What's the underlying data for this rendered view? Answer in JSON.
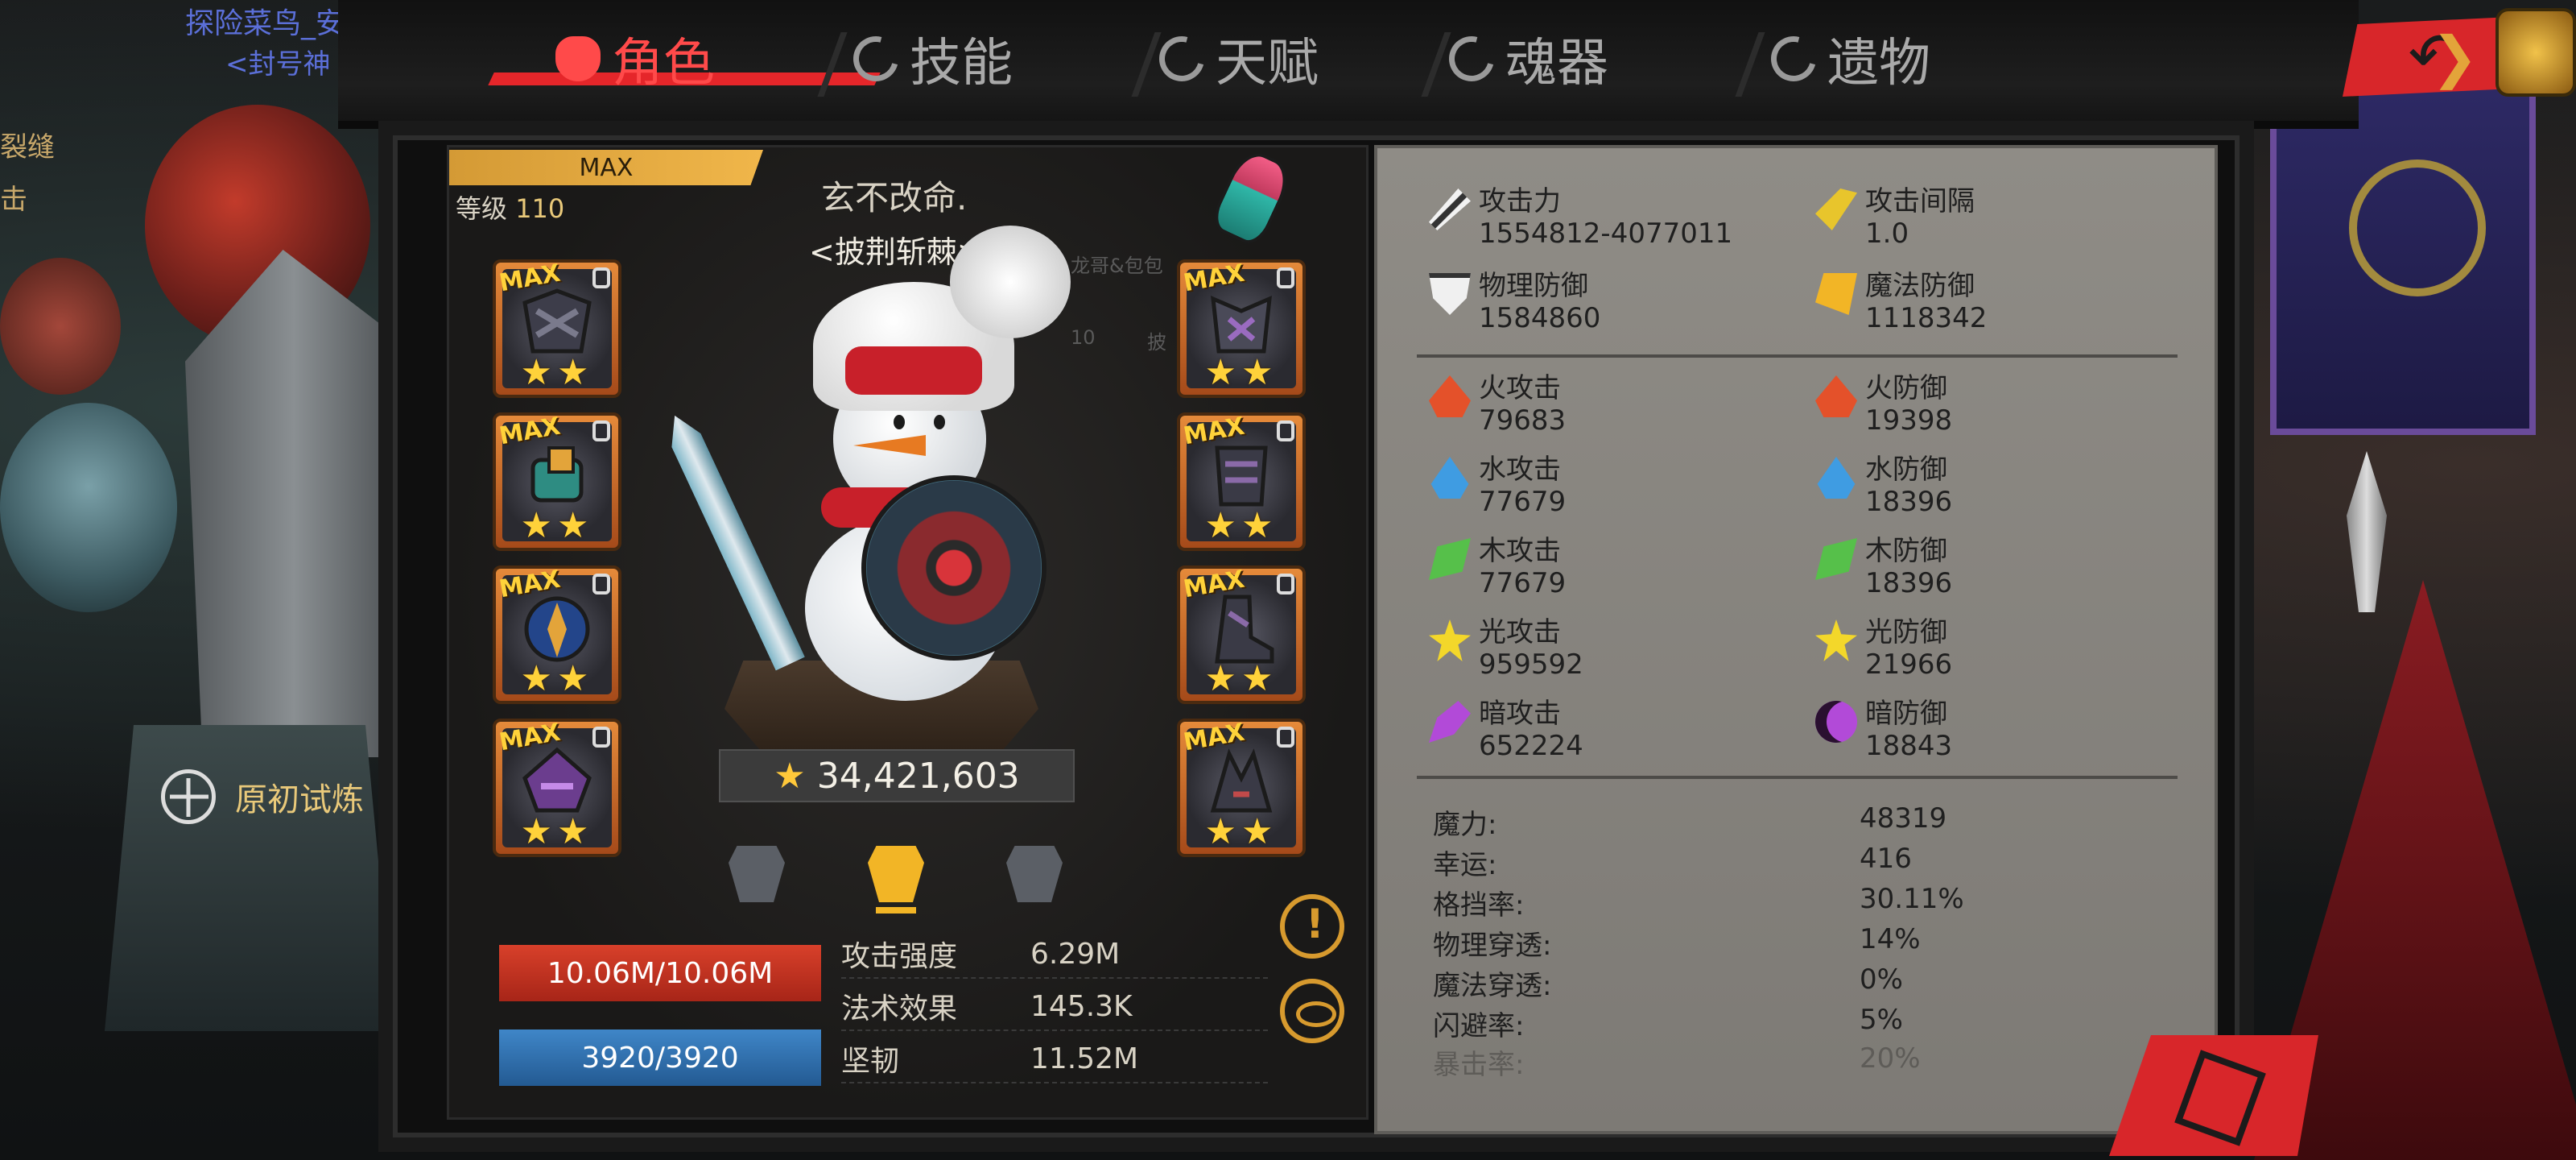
{
  "player": {
    "name": "探险菜鸟_安",
    "title": "<封号神"
  },
  "side_texts": [
    "裂缝",
    "击"
  ],
  "trial_button": {
    "label": "原初试炼",
    "icon": "crosshair-icon"
  },
  "tabs": [
    {
      "label": "角色",
      "icon": "devil-icon",
      "active": true
    },
    {
      "label": "技能",
      "icon": "swirl-icon",
      "active": false
    },
    {
      "label": "天赋",
      "icon": "flame-diamond-icon",
      "active": false
    },
    {
      "label": "魂器",
      "icon": "soul-icon",
      "active": false
    },
    {
      "label": "遗物",
      "icon": "relic-icon",
      "active": false
    }
  ],
  "character": {
    "rank_label": "MAX",
    "level_label": "等级",
    "level_value": "110",
    "name": "玄不改命.",
    "title": "<披荆斩棘>",
    "faint_text_1": "龙哥&包包",
    "faint_text_2": "10",
    "faint_text_3": "披",
    "power_score": "34,421,603"
  },
  "equipment_left": [
    {
      "name": "helmet",
      "tag": "MAX",
      "stars": "★★"
    },
    {
      "name": "bracer",
      "tag": "MAX",
      "stars": "★★"
    },
    {
      "name": "emblem",
      "tag": "MAX",
      "stars": "★★"
    },
    {
      "name": "hood",
      "tag": "MAX",
      "stars": "★★"
    }
  ],
  "equipment_right": [
    {
      "name": "chest",
      "tag": "MAX",
      "stars": "★★"
    },
    {
      "name": "greaves",
      "tag": "MAX",
      "stars": "★★"
    },
    {
      "name": "boots",
      "tag": "MAX",
      "stars": "★★"
    },
    {
      "name": "claw",
      "tag": "MAX",
      "stars": "★★"
    }
  ],
  "bars": {
    "hp": "10.06M/10.06M",
    "mp": "3920/3920",
    "hp_fill": 1.0,
    "mp_fill": 1.0
  },
  "mini_stats": [
    {
      "label": "攻击强度",
      "value": "6.29M"
    },
    {
      "label": "法术效果",
      "value": "145.3K"
    },
    {
      "label": "坚韧",
      "value": "11.52M"
    }
  ],
  "core_stats": [
    {
      "label": "攻击力",
      "value": "1554812-4077011",
      "icon": "sword-icon"
    },
    {
      "label": "攻击间隔",
      "value": "1.0",
      "icon": "wing-icon"
    },
    {
      "label": "物理防御",
      "value": "1584860",
      "icon": "shield-icon"
    },
    {
      "label": "魔法防御",
      "value": "1118342",
      "icon": "magic-shield-icon"
    }
  ],
  "element_stats": [
    {
      "atk_label": "火攻击",
      "atk_value": "79683",
      "def_label": "火防御",
      "def_value": "19398",
      "color": "#e4512a"
    },
    {
      "atk_label": "水攻击",
      "atk_value": "77679",
      "def_label": "水防御",
      "def_value": "18396",
      "color": "#3f9ce2"
    },
    {
      "atk_label": "木攻击",
      "atk_value": "77679",
      "def_label": "木防御",
      "def_value": "18396",
      "color": "#56c04a"
    },
    {
      "atk_label": "光攻击",
      "atk_value": "959592",
      "def_label": "光防御",
      "def_value": "21966",
      "color": "#f3d72a"
    },
    {
      "atk_label": "暗攻击",
      "atk_value": "652224",
      "def_label": "暗防御",
      "def_value": "18843",
      "color": "#b24ad8"
    }
  ],
  "misc_stats": [
    {
      "label": "魔力:",
      "value": "48319"
    },
    {
      "label": "幸运:",
      "value": "416"
    },
    {
      "label": "格挡率:",
      "value": "30.11%"
    },
    {
      "label": "物理穿透:",
      "value": "14%"
    },
    {
      "label": "魔法穿透:",
      "value": "0%"
    },
    {
      "label": "闪避率:",
      "value": "5%"
    },
    {
      "label": "暴击率:",
      "value": "20%"
    }
  ]
}
